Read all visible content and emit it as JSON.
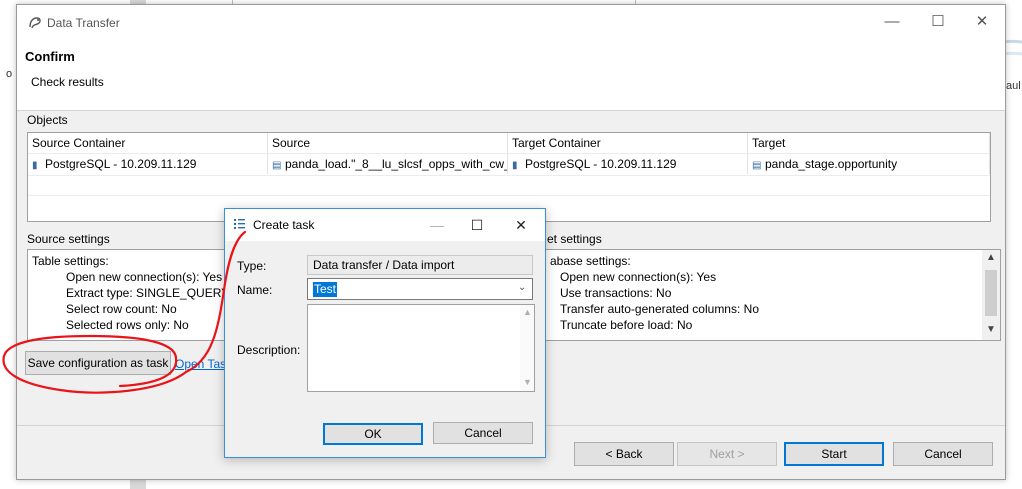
{
  "background": {
    "left_fragment": "o",
    "right_fragment": "aul"
  },
  "window": {
    "title": "Data Transfer",
    "minimize": "—",
    "maximize": "☐",
    "close": "✕"
  },
  "page": {
    "title": "Confirm",
    "subtitle": "Check results"
  },
  "objects": {
    "group_label": "Objects",
    "columns": [
      "Source Container",
      "Source",
      "Target Container",
      "Target"
    ],
    "rows": [
      [
        "PostgreSQL - 10.209.11.129",
        "panda_load.\"_8__lu_slcsf_opps_with_cw_...",
        "PostgreSQL - 10.209.11.129",
        "panda_stage.opportunity"
      ]
    ]
  },
  "source_settings": {
    "group_label": "Source settings",
    "heading": "Table settings:",
    "lines": [
      "Open new connection(s): Yes",
      "Extract type: SINGLE_QUERY",
      "Select row count: No",
      "Selected rows only: No"
    ]
  },
  "target_settings": {
    "group_label_visible": "et settings",
    "heading_visible": "abase settings:",
    "lines": [
      "Open new connection(s): Yes",
      "Use transactions: No",
      "Transfer auto-generated columns: No",
      "Truncate before load: No"
    ]
  },
  "actions": {
    "save_config": "Save configuration as task",
    "open_tasks_visible": "Open Task"
  },
  "footer": {
    "back": "< Back",
    "next": "Next >",
    "start": "Start",
    "cancel": "Cancel"
  },
  "create_task": {
    "title": "Create task",
    "minimize": "—",
    "maximize": "☐",
    "close": "✕",
    "type_label": "Type:",
    "type_value": "Data transfer / Data import",
    "name_label": "Name:",
    "name_value": "Test",
    "description_label": "Description:",
    "description_value": "",
    "ok": "OK",
    "cancel": "Cancel"
  },
  "colors": {
    "accent": "#0078d7",
    "link": "#0066cc",
    "annotation": "#e8141a"
  },
  "icons": [
    "dbeaver-app-icon",
    "database-icon",
    "table-icon",
    "task-list-icon",
    "chevron-down-icon",
    "scroll-up-icon",
    "scroll-down-icon"
  ]
}
